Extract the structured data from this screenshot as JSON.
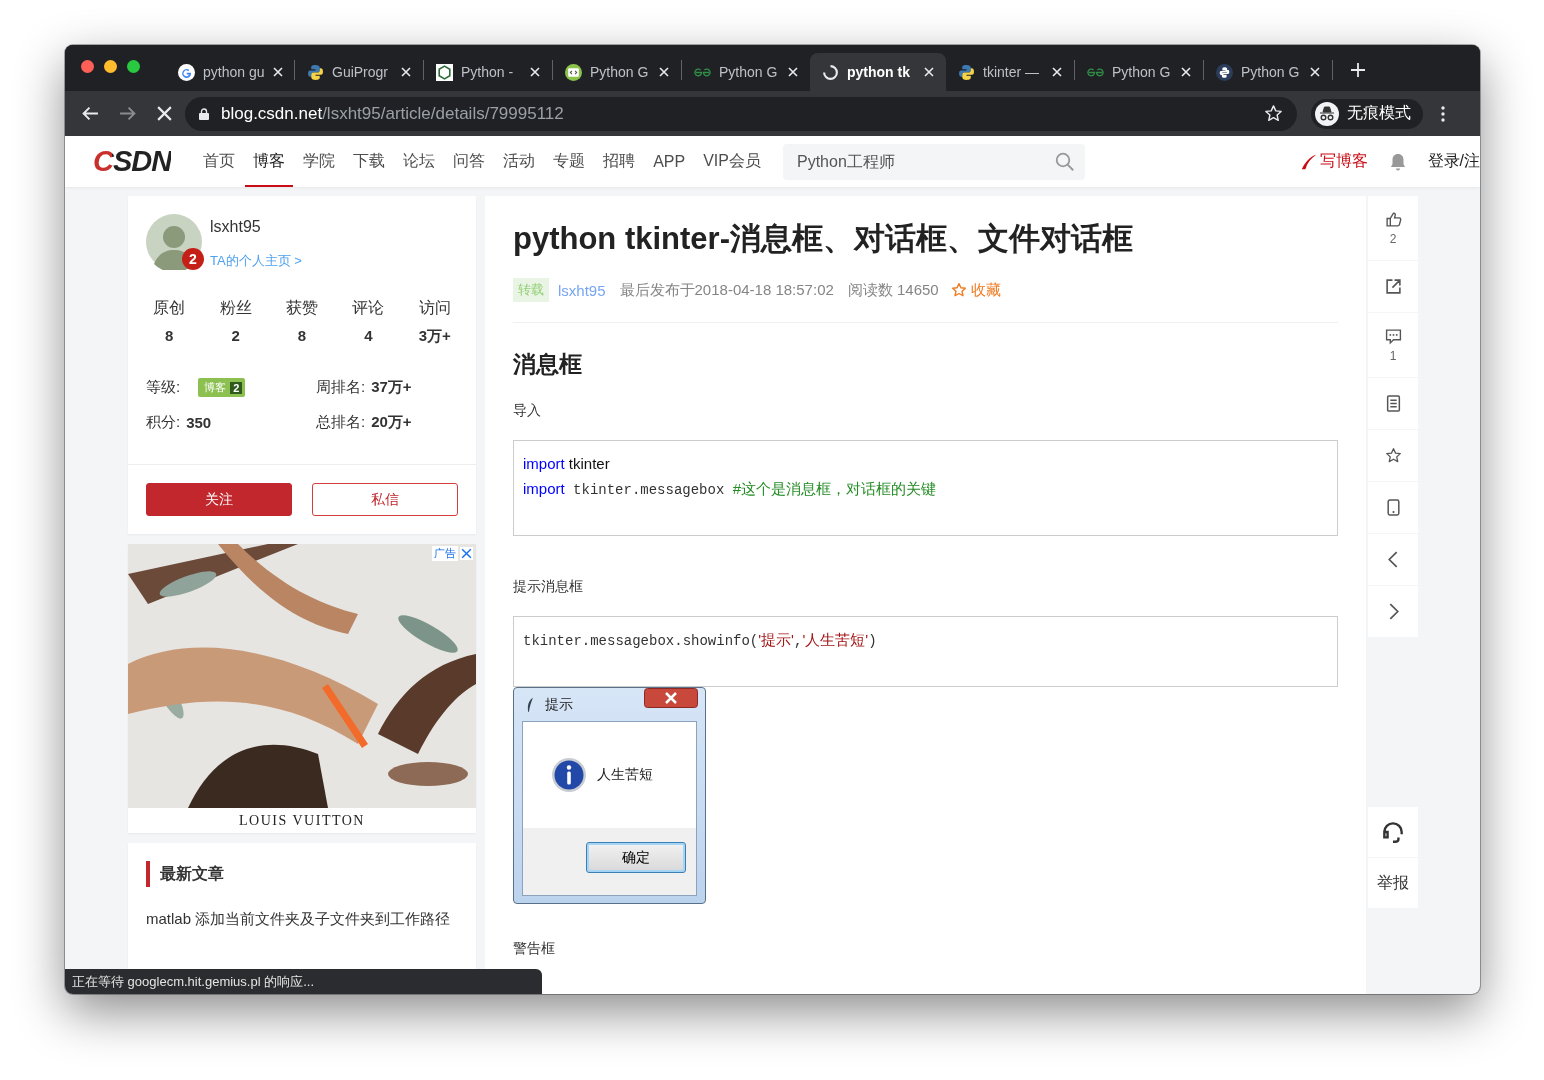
{
  "browser": {
    "tabs": [
      {
        "title": "python gu",
        "kind": "google",
        "selected": false
      },
      {
        "title": "GuiProgr",
        "kind": "python",
        "selected": false
      },
      {
        "title": "Python -",
        "kind": "box",
        "selected": false
      },
      {
        "title": "Python G",
        "kind": "green-circle",
        "selected": false
      },
      {
        "title": "Python G",
        "kind": "gg",
        "selected": false
      },
      {
        "title": "python tk",
        "kind": "loading",
        "selected": true
      },
      {
        "title": "tkinter —",
        "kind": "python",
        "selected": false
      },
      {
        "title": "Python G",
        "kind": "gg",
        "selected": false
      },
      {
        "title": "Python G",
        "kind": "python-dark",
        "selected": false
      }
    ],
    "address": {
      "host": "blog.csdn.net",
      "path": "/lsxht95/article/details/79995112"
    },
    "incognito_label": "无痕模式"
  },
  "site_header": {
    "logo": "CSDN",
    "nav": [
      {
        "label": "首页",
        "selected": false
      },
      {
        "label": "博客",
        "selected": true
      },
      {
        "label": "学院",
        "selected": false
      },
      {
        "label": "下载",
        "selected": false
      },
      {
        "label": "论坛",
        "selected": false
      },
      {
        "label": "问答",
        "selected": false
      },
      {
        "label": "活动",
        "selected": false
      },
      {
        "label": "专题",
        "selected": false
      },
      {
        "label": "招聘",
        "selected": false
      },
      {
        "label": "APP",
        "selected": false
      },
      {
        "label": "VIP会员",
        "selected": false
      }
    ],
    "search": {
      "placeholder": "Python工程师"
    },
    "write_link": "写博客",
    "login": "登录/注"
  },
  "profile": {
    "name": "lsxht95",
    "badge": "2",
    "home_link": "TA的个人主页 >",
    "stats": [
      {
        "label": "原创",
        "value": "8"
      },
      {
        "label": "粉丝",
        "value": "2"
      },
      {
        "label": "获赞",
        "value": "8"
      },
      {
        "label": "评论",
        "value": "4"
      },
      {
        "label": "访问",
        "value": "3万+"
      }
    ],
    "level": {
      "label": "等级:",
      "badge_text": "博客",
      "badge_level": "2"
    },
    "ranks": [
      {
        "label": "周排名:",
        "value": "37万+"
      },
      {
        "label": "积分:",
        "value": "350"
      },
      {
        "label": "总排名:",
        "value": "20万+"
      }
    ],
    "buttons": [
      {
        "label": "关注",
        "kind": "primary"
      },
      {
        "label": "私信",
        "kind": "outline"
      }
    ]
  },
  "ad": {
    "label": "广告",
    "caption": "LOUIS VUITTON"
  },
  "recent": {
    "title": "最新文章",
    "items": [
      "matlab 添加当前文件夹及子文件夹到工作路径"
    ]
  },
  "article": {
    "title": "python tkinter-消息框、对话框、文件对话框",
    "meta": {
      "tag": "转载",
      "author": "lsxht95",
      "date": "最后发布于2018-04-18 18:57:02",
      "reads": "阅读数 14650",
      "favorite": "收藏"
    },
    "blocks": [
      {
        "kind": "heading",
        "text": "消息框"
      },
      {
        "kind": "paragraph",
        "text": "导入"
      },
      {
        "kind": "code",
        "lines": [
          [
            {
              "kind": "keyword",
              "text": "import"
            },
            {
              "kind": "plain",
              "text": " tkinter"
            }
          ],
          [
            {
              "kind": "keyword",
              "text": "import"
            },
            {
              "kind": "mono",
              "text": " tkinter.messagebox "
            },
            {
              "kind": "comment",
              "text": "#这个是消息框，对话框的关键"
            }
          ]
        ]
      },
      {
        "kind": "paragraph",
        "text": "提示消息框"
      },
      {
        "kind": "code",
        "lines": [
          [
            {
              "kind": "mono",
              "text": "tkinter.messagebox.showinfo("
            },
            {
              "kind": "string",
              "text": "'提示'"
            },
            {
              "kind": "mono",
              "text": ","
            },
            {
              "kind": "string",
              "text": "'人生苦短'"
            },
            {
              "kind": "mono",
              "text": ")"
            }
          ]
        ]
      },
      {
        "kind": "dialog",
        "title": "提示",
        "message": "人生苦短",
        "button": "确定"
      },
      {
        "kind": "paragraph",
        "text": "警告框"
      }
    ]
  },
  "side_tools": [
    {
      "kind": "thumb-up",
      "count": "2"
    },
    {
      "kind": "share"
    },
    {
      "kind": "comment",
      "count": "1"
    },
    {
      "kind": "list"
    },
    {
      "kind": "star"
    },
    {
      "kind": "phone"
    },
    {
      "kind": "chevron-left"
    },
    {
      "kind": "chevron-right"
    }
  ],
  "report": "举报",
  "status_bar": "正在等待 googlecm.hit.gemius.pl 的响应..."
}
